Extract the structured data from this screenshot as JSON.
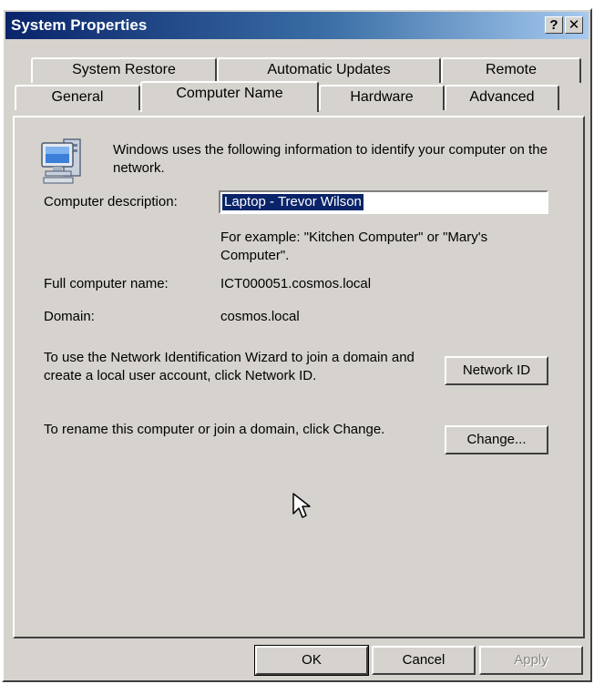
{
  "window": {
    "title": "System Properties",
    "help_label": "?",
    "close_label": "✕"
  },
  "tabs": {
    "row1": [
      "System Restore",
      "Automatic Updates",
      "Remote"
    ],
    "row2": [
      "General",
      "Computer Name",
      "Hardware",
      "Advanced"
    ],
    "active": "Computer Name"
  },
  "content": {
    "intro": "Windows uses the following information to identify your computer on the network.",
    "description_label": "Computer description:",
    "description_value": "Laptop - Trevor Wilson",
    "example_text": "For example: \"Kitchen Computer\" or \"Mary's Computer\".",
    "full_name_label": "Full computer name:",
    "full_name_value": "ICT000051.cosmos.local",
    "domain_label": "Domain:",
    "domain_value": "cosmos.local",
    "network_id_text": "To use the Network Identification Wizard to join a domain and create a local user account, click Network ID.",
    "network_id_button": "Network ID",
    "rename_text": "To rename this computer or join a domain, click Change.",
    "change_button": "Change..."
  },
  "footer": {
    "ok": "OK",
    "cancel": "Cancel",
    "apply": "Apply"
  },
  "icons": {
    "computer": "computer-icon",
    "cursor": "mouse-pointer-icon"
  }
}
